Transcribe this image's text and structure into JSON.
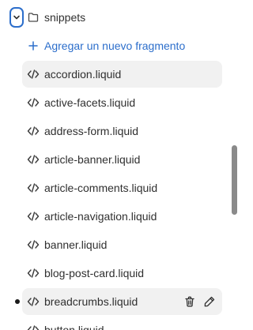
{
  "folder": {
    "name": "snippets",
    "expanded": true
  },
  "add_action": {
    "label": "Agregar un nuevo fragmento"
  },
  "files": [
    {
      "name": "accordion.liquid",
      "state": "hover"
    },
    {
      "name": "active-facets.liquid",
      "state": "normal"
    },
    {
      "name": "address-form.liquid",
      "state": "normal"
    },
    {
      "name": "article-banner.liquid",
      "state": "normal"
    },
    {
      "name": "article-comments.liquid",
      "state": "normal"
    },
    {
      "name": "article-navigation.liquid",
      "state": "normal"
    },
    {
      "name": "banner.liquid",
      "state": "normal"
    },
    {
      "name": "blog-post-card.liquid",
      "state": "normal"
    },
    {
      "name": "breadcrumbs.liquid",
      "state": "selected",
      "modified": true
    },
    {
      "name": "button.liquid",
      "state": "normal"
    }
  ],
  "colors": {
    "accent": "#2c6ecb",
    "text": "#303030",
    "row_highlight": "#f1f1f1",
    "scrollbar": "#8a8a8a"
  },
  "icons": {
    "chevron": "chevron-down-icon",
    "folder": "folder-icon",
    "add": "plus-icon",
    "file": "code-icon",
    "delete": "trash-icon",
    "rename": "pencil-icon"
  }
}
